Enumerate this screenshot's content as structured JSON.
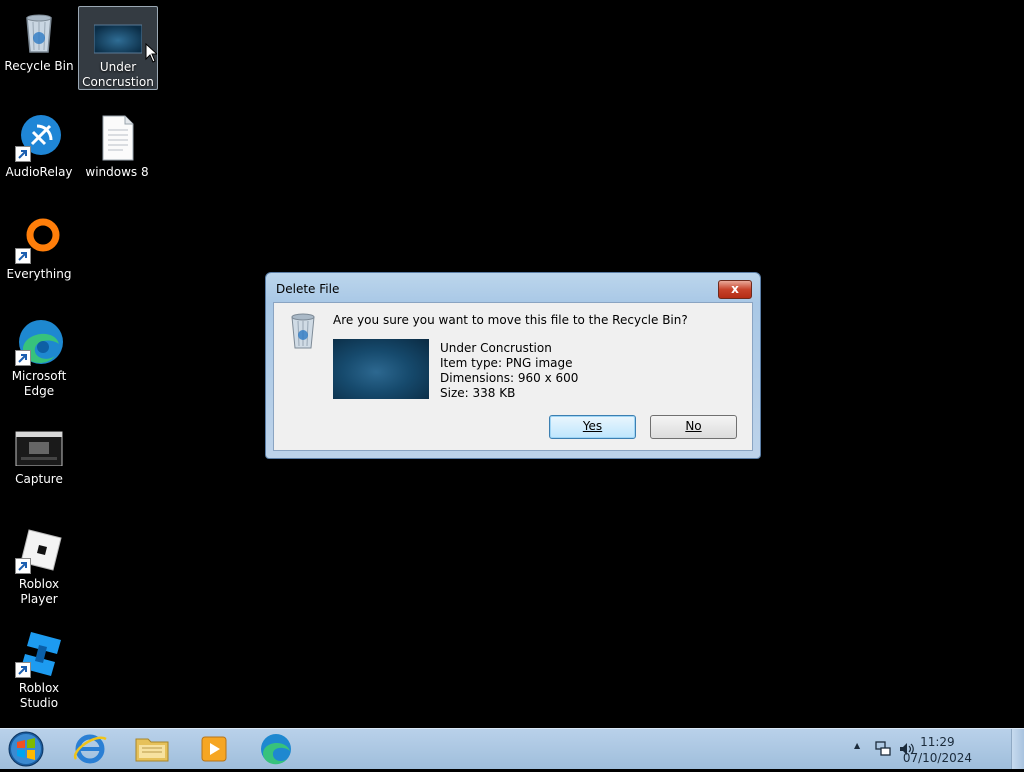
{
  "desktop": {
    "icons": [
      {
        "label": "Recycle Bin"
      },
      {
        "label": "Under Concrustion"
      },
      {
        "label": "AudioRelay"
      },
      {
        "label": "windows 8"
      },
      {
        "label": "Everything"
      },
      {
        "label": "Microsoft Edge"
      },
      {
        "label": "Capture"
      },
      {
        "label": "Roblox Player"
      },
      {
        "label": "Roblox Studio"
      }
    ]
  },
  "dialog": {
    "title": "Delete File",
    "close_label": "x",
    "question": "Are you sure you want to move this file to the Recycle Bin?",
    "file_name": "Under Concrustion",
    "item_type": "Item type: PNG image",
    "dimensions": "Dimensions: 960 x 600",
    "size": "Size: 338 KB",
    "yes_label": "Yes",
    "no_label": "No"
  },
  "taskbar": {
    "start": "start-orb",
    "pinned": [
      "internet-explorer-icon",
      "file-explorer-icon",
      "media-player-icon",
      "edge-icon"
    ],
    "tray": {
      "chevron": "▲",
      "network": "network-icon",
      "volume": "volume-icon"
    },
    "clock_time": "11:29",
    "clock_date": "07/10/2024"
  },
  "colors": {
    "dialog_frame": "#a9c8e6",
    "close_button": "#c7432b",
    "taskbar": "#b9d1ea"
  }
}
